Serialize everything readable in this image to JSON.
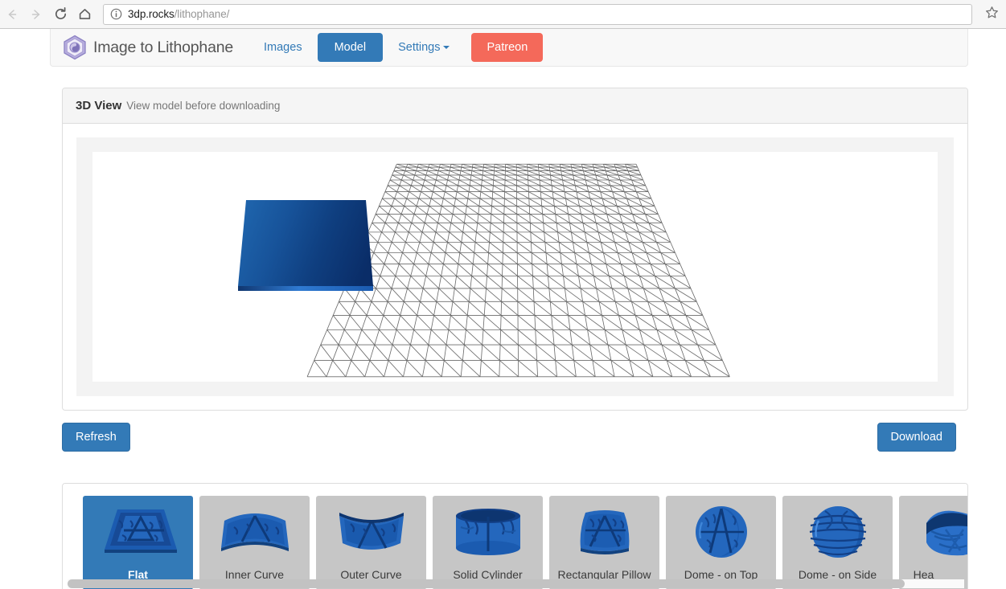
{
  "browser": {
    "back_icon": "back-arrow-icon",
    "forward_icon": "forward-arrow-icon",
    "reload_icon": "reload-icon",
    "home_icon": "home-icon",
    "info_icon": "page-info-icon",
    "url_domain": "3dp.rocks",
    "url_path": "/lithophane/",
    "bookmark_icon": "star-icon"
  },
  "navbar": {
    "brand": "Image to Lithophane",
    "logo_icon": "hexagon-logo-icon",
    "items": [
      {
        "label": "Images",
        "active": false,
        "style": "link"
      },
      {
        "label": "Model",
        "active": true,
        "style": "button"
      },
      {
        "label": "Settings",
        "active": false,
        "style": "dropdown"
      }
    ],
    "patreon_label": "Patreon",
    "accent_color": "#337ab7",
    "patreon_color": "#f4695a"
  },
  "panel": {
    "title": "3D View",
    "subtitle": "View model before downloading"
  },
  "actions": {
    "refresh_label": "Refresh",
    "download_label": "Download"
  },
  "viewport": {
    "grid_rows": 22,
    "grid_cols": 22,
    "grid_color": "#6b6b6b",
    "model_color_light": "#1f63a8",
    "model_color_dark": "#0b2f6b",
    "model_edge_color": "#2f7ad1",
    "background": "#ffffff"
  },
  "thumbnails": [
    {
      "label": "Flat",
      "shape": "flat-plate",
      "selected": true
    },
    {
      "label": "Inner Curve",
      "shape": "inner-curve",
      "selected": false
    },
    {
      "label": "Outer Curve",
      "shape": "outer-curve",
      "selected": false
    },
    {
      "label": "Solid Cylinder",
      "shape": "cylinder",
      "selected": false
    },
    {
      "label": "Rectangular Pillow",
      "shape": "pillow",
      "selected": false
    },
    {
      "label": "Dome - on Top",
      "shape": "dome-top",
      "selected": false
    },
    {
      "label": "Dome - on Side",
      "shape": "dome-side",
      "selected": false
    },
    {
      "label": "Hea",
      "shape": "heart",
      "selected": false
    }
  ],
  "scrollbar": {
    "orientation": "horizontal",
    "position": "bottom"
  }
}
